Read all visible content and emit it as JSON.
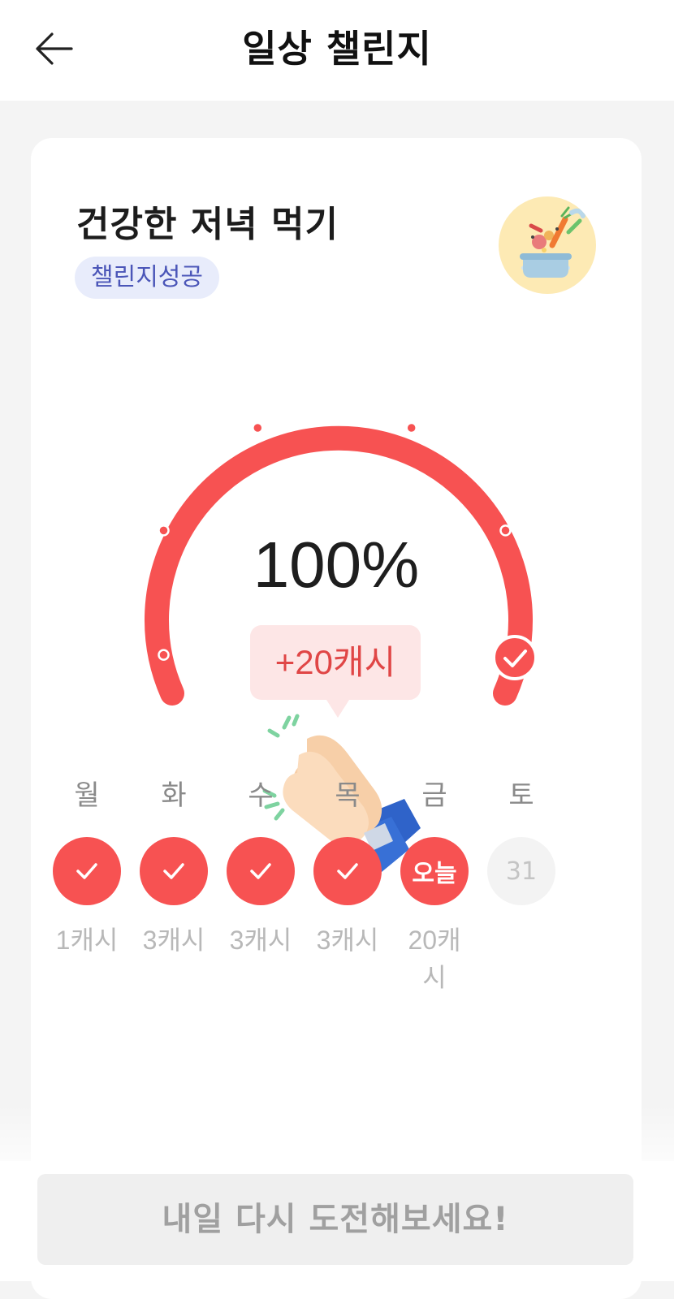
{
  "header": {
    "title": "일상 챌린지",
    "back_icon": "arrow-left-icon"
  },
  "challenge": {
    "title": "건강한 저녁 먹기",
    "status": "챌린지성공",
    "image_icon": "cooking-pot-icon",
    "progress_percent": 100,
    "progress_label": "100%",
    "reward": "+20캐시",
    "celebration_icon": "clapping-hands-icon"
  },
  "week": [
    {
      "day": "월",
      "state": "done",
      "cash": "1캐시"
    },
    {
      "day": "화",
      "state": "done",
      "cash": "3캐시"
    },
    {
      "day": "수",
      "state": "done",
      "cash": "3캐시"
    },
    {
      "day": "목",
      "state": "done",
      "cash": "3캐시"
    },
    {
      "day": "금",
      "state": "today",
      "label": "오늘",
      "cash": "20캐시"
    },
    {
      "day": "토",
      "state": "future",
      "label": "31",
      "cash": ""
    }
  ],
  "footer": {
    "button_label": "내일 다시 도전해보세요!"
  },
  "colors": {
    "accent": "#f75252",
    "badge_bg": "#e8ecfb",
    "badge_text": "#4b56b8"
  }
}
